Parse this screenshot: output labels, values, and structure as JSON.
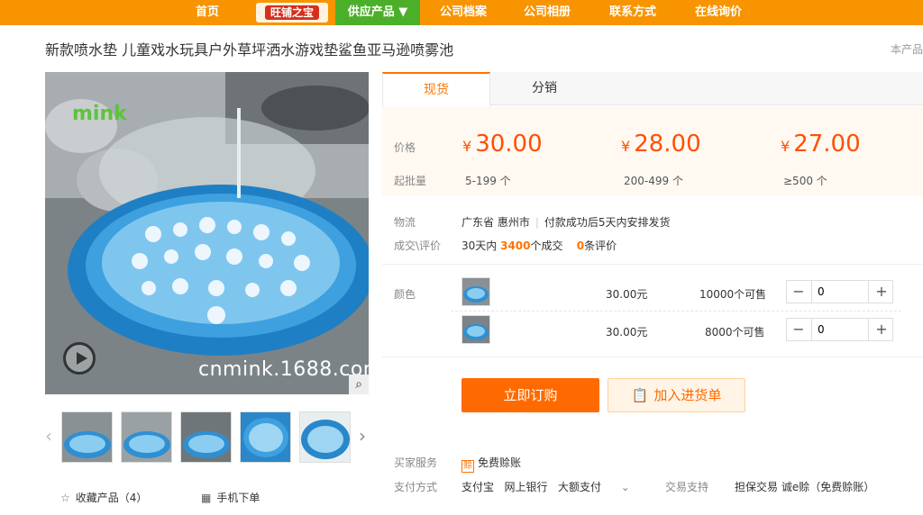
{
  "nav": {
    "items": [
      "首页",
      "旺铺之宝",
      "供应产品 ▼",
      "公司档案",
      "公司相册",
      "联系方式",
      "在线询价"
    ]
  },
  "product": {
    "title": "新款喷水垫 儿童戏水玩具户外草坪洒水游戏垫鲨鱼亚马逊喷雾池",
    "title_right": "本产品",
    "watermark": "cnmink.1688.com",
    "logo_text": "mink",
    "fav_label": "收藏产品（4）",
    "mobile_label": "手机下单"
  },
  "tabs": [
    "现货",
    "分销"
  ],
  "pricing": {
    "price_label": "价格",
    "moq_label": "起批量",
    "currency": "¥",
    "tiers": [
      {
        "price": "30.00",
        "range": "5-199 个"
      },
      {
        "price": "28.00",
        "range": "200-499 个"
      },
      {
        "price": "27.00",
        "range": "≥500 个"
      }
    ]
  },
  "logistics": {
    "label": "物流",
    "location": "广东省 惠州市",
    "delivery": "付款成功后5天内安排发货"
  },
  "deals": {
    "label": "成交\\评价",
    "prefix": "30天内",
    "count": "3400",
    "count_suffix": "个成交",
    "reviews": "0",
    "reviews_suffix": "条评价"
  },
  "sku": {
    "label": "颜色",
    "rows": [
      {
        "price": "30.00元",
        "stock": "10000个可售",
        "qty": "0"
      },
      {
        "price": "30.00元",
        "stock": "8000个可售",
        "qty": "0"
      }
    ]
  },
  "actions": {
    "order": "立即订购",
    "cart": "加入进货单"
  },
  "service": {
    "label": "买家服务",
    "badge": "赊",
    "value": "免费赊账"
  },
  "payment": {
    "label": "支付方式",
    "methods": [
      "支付宝",
      "网上银行",
      "大额支付"
    ],
    "trade_label": "交易支持",
    "trade_value": "担保交易  诚e赊（免费赊账）"
  },
  "colors": {
    "accent": "#ff6a00",
    "nav_bg": "#f79400",
    "nav_active": "#4caf2a"
  }
}
